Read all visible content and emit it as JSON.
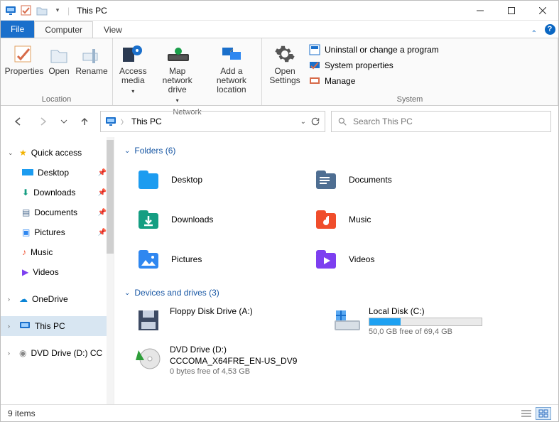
{
  "title": "This PC",
  "tabs": {
    "file": "File",
    "computer": "Computer",
    "view": "View"
  },
  "ribbon": {
    "location": {
      "label": "Location",
      "properties": "Properties",
      "open": "Open",
      "rename": "Rename"
    },
    "network": {
      "label": "Network",
      "access": "Access media",
      "map": "Map network drive",
      "add": "Add a network location"
    },
    "settings": {
      "open": "Open Settings"
    },
    "system": {
      "label": "System",
      "uninstall": "Uninstall or change a program",
      "props": "System properties",
      "manage": "Manage"
    }
  },
  "address": {
    "crumb": "This PC"
  },
  "search": {
    "placeholder": "Search This PC"
  },
  "sidebar": {
    "quick": "Quick access",
    "items": [
      "Desktop",
      "Downloads",
      "Documents",
      "Pictures",
      "Music",
      "Videos"
    ],
    "onedrive": "OneDrive",
    "thispc": "This PC",
    "dvd": "DVD Drive (D:) CC"
  },
  "sections": {
    "folders_title": "Folders (6)",
    "folders": [
      {
        "name": "Desktop",
        "bg": "#1c9cf0"
      },
      {
        "name": "Documents",
        "bg": "#4e6e92"
      },
      {
        "name": "Downloads",
        "bg": "#159e82"
      },
      {
        "name": "Music",
        "bg": "#f04d2b"
      },
      {
        "name": "Pictures",
        "bg": "#2f87f0"
      },
      {
        "name": "Videos",
        "bg": "#7d3ff0"
      }
    ],
    "drives_title": "Devices and drives (3)",
    "floppy": {
      "name": "Floppy Disk Drive (A:)"
    },
    "local": {
      "name": "Local Disk (C:)",
      "free": "50,0 GB free of 69,4 GB",
      "fill": 28
    },
    "dvd": {
      "name": "DVD Drive (D:)",
      "detail": "CCCOMA_X64FRE_EN-US_DV9",
      "free": "0 bytes free of 4,53 GB"
    }
  },
  "status": {
    "count": "9 items"
  }
}
